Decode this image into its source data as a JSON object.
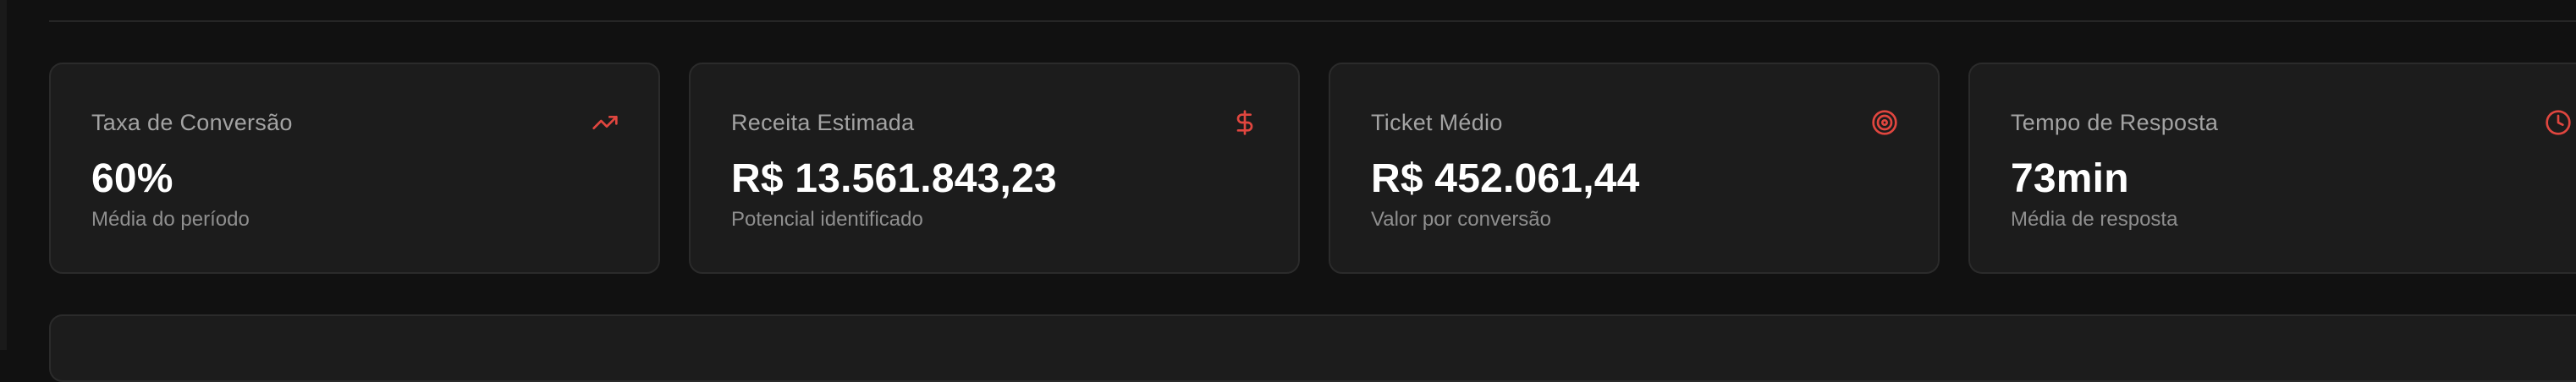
{
  "kpis": [
    {
      "title": "Taxa de Conversão",
      "value": "60%",
      "subtitle": "Média do período",
      "icon": "trending-up-icon"
    },
    {
      "title": "Receita Estimada",
      "value": "R$ 13.561.843,23",
      "subtitle": "Potencial identificado",
      "icon": "dollar-icon"
    },
    {
      "title": "Ticket Médio",
      "value": "R$ 452.061,44",
      "subtitle": "Valor por conversão",
      "icon": "target-icon"
    },
    {
      "title": "Tempo de Resposta",
      "value": "73min",
      "subtitle": "Média de resposta",
      "icon": "clock-icon"
    }
  ],
  "colors": {
    "background": "#111111",
    "card": "#1c1c1c",
    "accent": "#e0463f"
  }
}
